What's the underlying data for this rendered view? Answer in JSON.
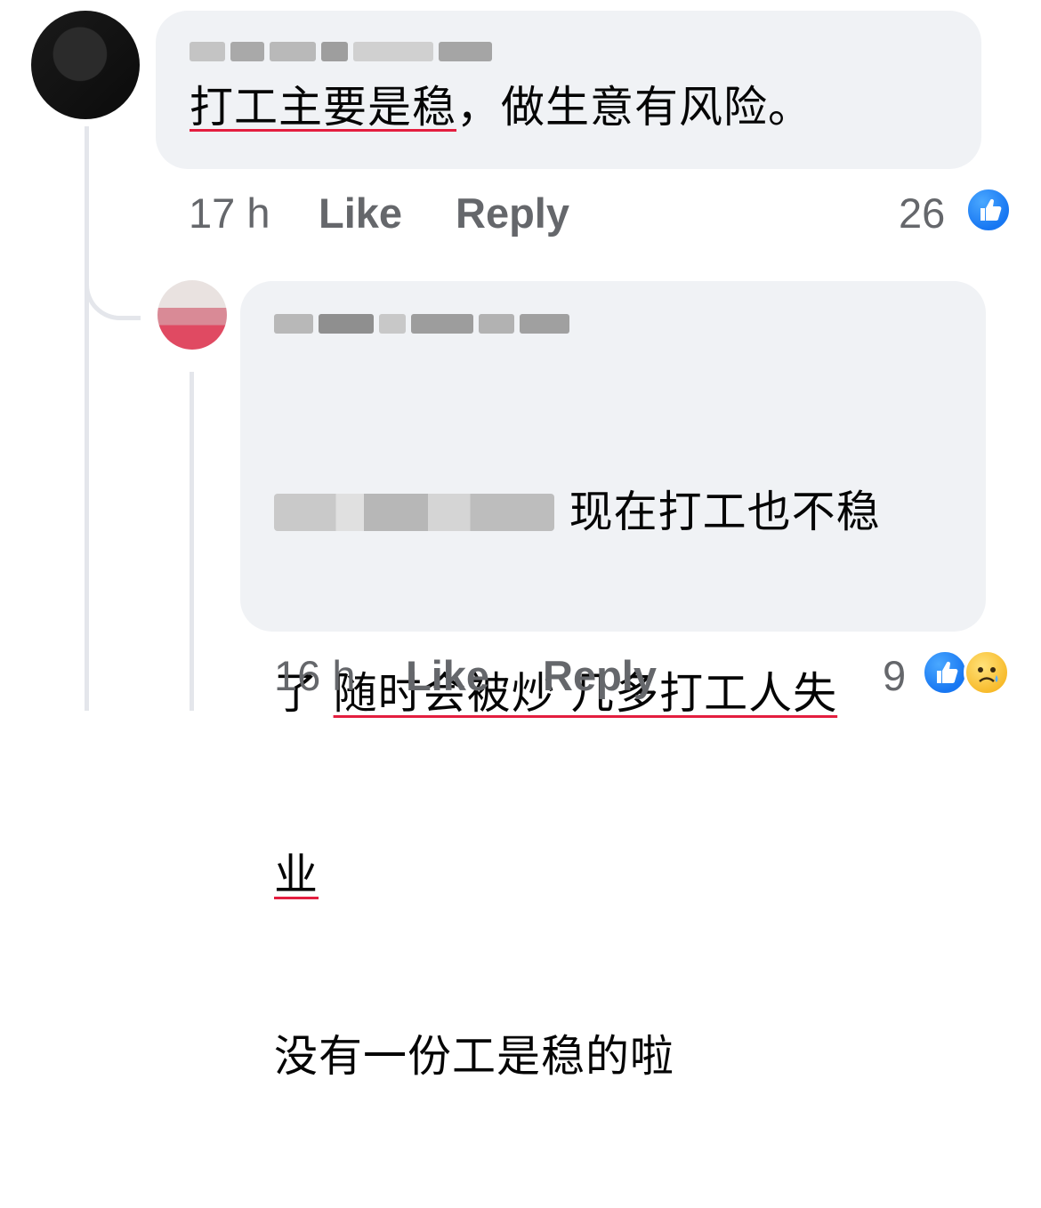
{
  "comment1": {
    "author_blurred": true,
    "text_underlined": "打工主要是稳",
    "text_rest": "，做生意有风险。",
    "timestamp": "17 h",
    "like_label": "Like",
    "reply_label": "Reply",
    "reaction_count": "26",
    "reactions": [
      "like-icon"
    ]
  },
  "comment2": {
    "author_blurred": true,
    "mention_blurred": true,
    "line1_rest": " 现在打工也不稳",
    "line2_start": "了 ",
    "line2_underlined": "随时会被炒 几多打工人失",
    "line3_underlined": "业",
    "line4": "没有一份工是稳的啦",
    "timestamp": "16 h",
    "like_label": "Like",
    "reply_label": "Reply",
    "reaction_count": "9",
    "reactions": [
      "like-icon",
      "sad-icon"
    ]
  },
  "colors": {
    "bubble": "#f0f2f5",
    "meta_text": "#65676b",
    "underline": "#e41e3f",
    "like_blue": "#1877f2",
    "sad_yellow": "#f7b928",
    "thread_line": "#e4e6eb"
  }
}
